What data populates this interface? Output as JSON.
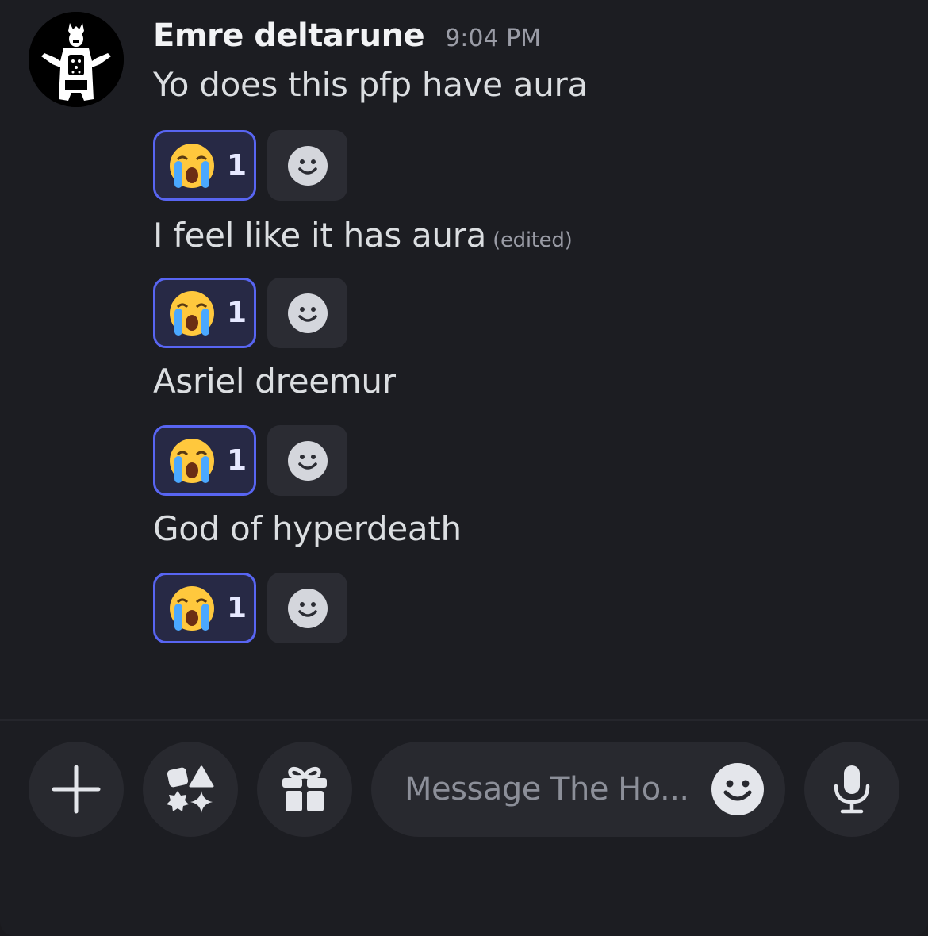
{
  "message": {
    "author": "Emre deltarune",
    "timestamp": "9:04 PM",
    "lines": [
      {
        "text": "Yo does this pfp have aura",
        "edited": null
      },
      {
        "text": "I feel like it has aura",
        "edited": "(edited)"
      },
      {
        "text": "Asriel dreemur",
        "edited": null
      },
      {
        "text": "God of hyperdeath",
        "edited": null
      }
    ],
    "reactions": [
      {
        "emoji": "loudly-crying-face",
        "count": "1"
      },
      {
        "emoji": "loudly-crying-face",
        "count": "1"
      },
      {
        "emoji": "loudly-crying-face",
        "count": "1"
      },
      {
        "emoji": "loudly-crying-face",
        "count": "1"
      }
    ]
  },
  "composer": {
    "placeholder": "Message The Ho...",
    "buttons": [
      "plus-icon",
      "apps-icon",
      "gift-icon",
      "microphone-icon"
    ]
  },
  "colors": {
    "background": "#1c1d22",
    "reaction_border": "#5865f2",
    "reaction_bg": "#272945",
    "button_bg": "#28292f"
  }
}
